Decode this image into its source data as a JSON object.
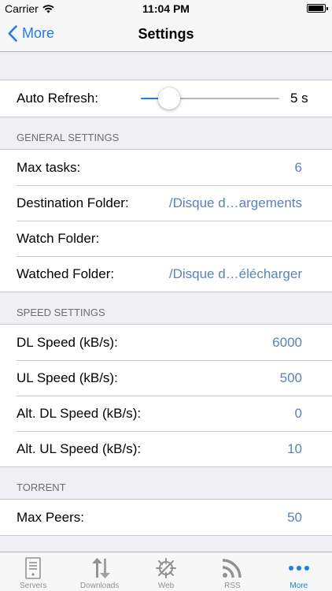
{
  "status_bar": {
    "carrier": "Carrier",
    "time": "11:04 PM"
  },
  "nav": {
    "back_label": "More",
    "title": "Settings"
  },
  "auto_refresh": {
    "label": "Auto Refresh:",
    "value_text": "5 s",
    "slider_fraction": 0.15
  },
  "general": {
    "header": "GENERAL SETTINGS",
    "rows": [
      {
        "label": "Max tasks:",
        "value": "6"
      },
      {
        "label": "Destination Folder:",
        "value": "/Disque d…argements"
      },
      {
        "label": "Watch Folder:",
        "value": ""
      },
      {
        "label": "Watched Folder:",
        "value": "/Disque d…élécharger"
      }
    ]
  },
  "speed": {
    "header": "SPEED SETTINGS",
    "rows": [
      {
        "label": "DL Speed (kB/s):",
        "value": "6000"
      },
      {
        "label": "UL Speed (kB/s):",
        "value": "500"
      },
      {
        "label": "Alt. DL Speed (kB/s):",
        "value": "0"
      },
      {
        "label": "Alt. UL Speed (kB/s):",
        "value": "10"
      }
    ]
  },
  "torrent": {
    "header": "TORRENT",
    "rows": [
      {
        "label": "Max Peers:",
        "value": "50"
      }
    ]
  },
  "tabbar": {
    "items": [
      {
        "label": "Servers",
        "icon": "servers-icon"
      },
      {
        "label": "Downloads",
        "icon": "downloads-icon"
      },
      {
        "label": "Web",
        "icon": "web-icon"
      },
      {
        "label": "RSS",
        "icon": "rss-icon"
      },
      {
        "label": "More",
        "icon": "more-icon"
      }
    ],
    "active_index": 4
  },
  "colors": {
    "accent": "#1e7ee8",
    "value_text": "#5a84b8",
    "background": "#efeff4"
  }
}
